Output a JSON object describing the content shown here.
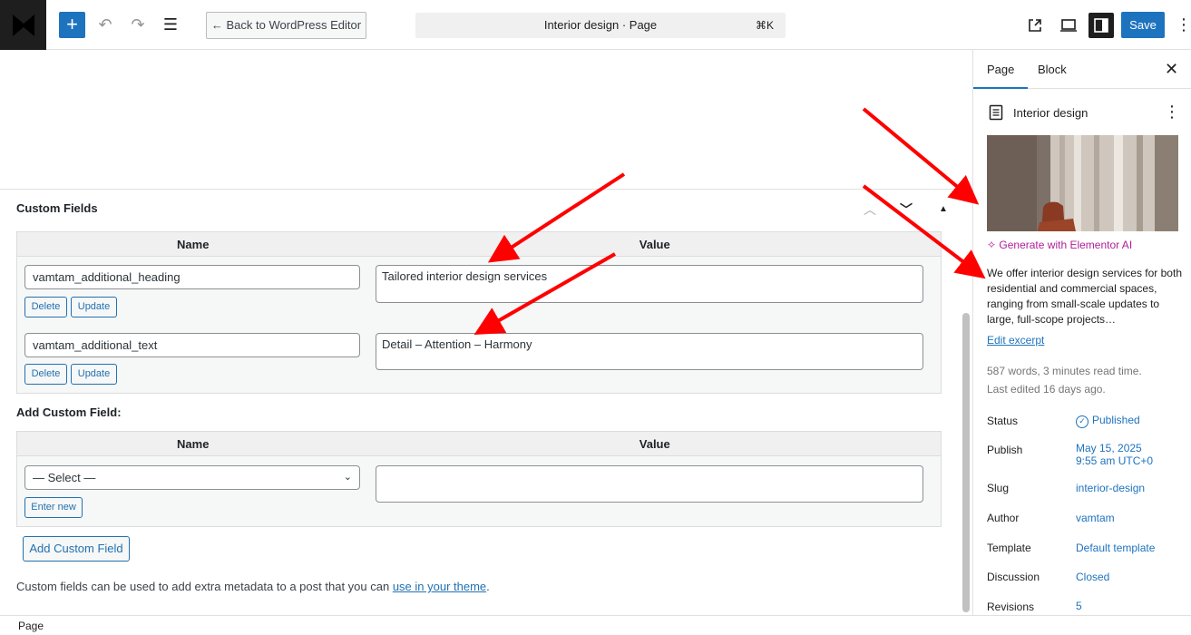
{
  "topbar": {
    "back_label": "← Back to WordPress Editor",
    "doc_title": "Interior design · Page",
    "shortcut": "⌘K",
    "save_label": "Save"
  },
  "custom_fields": {
    "title": "Custom Fields",
    "col_name": "Name",
    "col_value": "Value",
    "rows": [
      {
        "name": "vamtam_additional_heading",
        "value": "Tailored interior design services",
        "delete": "Delete",
        "update": "Update"
      },
      {
        "name": "vamtam_additional_text",
        "value": "Detail – Attention – Harmony",
        "delete": "Delete",
        "update": "Update"
      }
    ],
    "add_title": "Add Custom Field:",
    "add_col_name": "Name",
    "add_col_value": "Value",
    "select_value": "— Select —",
    "enter_new": "Enter new",
    "add_button": "Add Custom Field",
    "note_prefix": "Custom fields can be used to add extra metadata to a post that you can ",
    "note_link": "use in your theme",
    "note_suffix": "."
  },
  "sidebar": {
    "tab_page": "Page",
    "tab_block": "Block",
    "doc_title": "Interior design",
    "generate_ai": "Generate with Elementor AI",
    "excerpt": "We offer interior design services for both residential and commercial spaces, ranging from small-scale updates to large, full-scope projects…",
    "edit_excerpt": "Edit excerpt",
    "stats_line1": "587 words, 3 minutes read time.",
    "stats_line2": "Last edited 16 days ago.",
    "status_label": "Status",
    "status_value": "Published",
    "publish_label": "Publish",
    "publish_value1": "May 15, 2025",
    "publish_value2": "9:55 am UTC+0",
    "slug_label": "Slug",
    "slug_value": "interior-design",
    "author_label": "Author",
    "author_value": "vamtam",
    "template_label": "Template",
    "template_value": "Default template",
    "discussion_label": "Discussion",
    "discussion_value": "Closed",
    "revisions_label": "Revisions",
    "revisions_value": "5"
  },
  "footer": {
    "breadcrumb": "Page"
  },
  "colors": {
    "accent": "#1e73be",
    "arrow": "#ff0000",
    "ai": "#b0209a"
  }
}
